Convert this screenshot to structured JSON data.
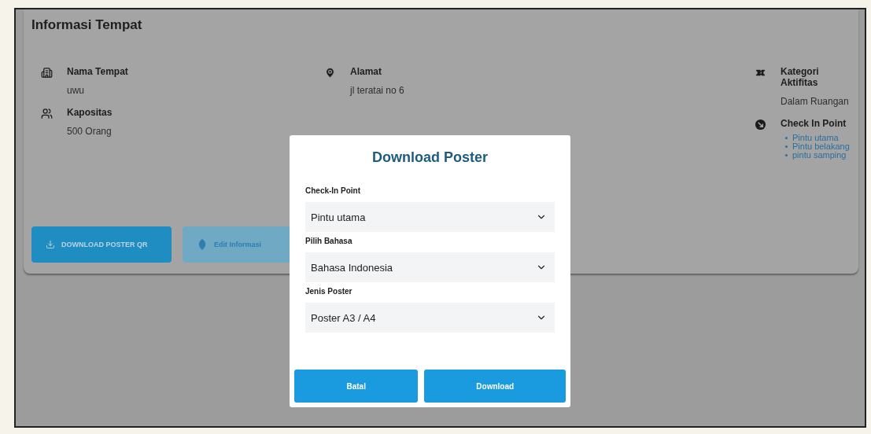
{
  "page": {
    "title": "Informasi Tempat"
  },
  "columns": [
    [
      {
        "kind": "text",
        "label": "Nama Tempat",
        "value": "uwu"
      },
      {
        "kind": "text",
        "label": "Kapositas",
        "value": "500 Orang"
      }
    ],
    [
      {
        "kind": "text",
        "label": "Alamat",
        "value": "jl teratai no 6"
      }
    ],
    [
      {
        "kind": "text",
        "label": "Kategori Aktifitas",
        "value": "Dalam Ruangan"
      },
      {
        "kind": "list",
        "label": "Check In Point",
        "items": [
          "Pintu utama",
          "Pintu belakang",
          "pintu samping"
        ]
      }
    ]
  ],
  "actions": [
    {
      "kind": "primary",
      "label": "DOWNLOAD POSTER QR"
    },
    {
      "kind": "secondary",
      "label": "Edit Informasi"
    }
  ],
  "dialog": {
    "title": "Download Poster",
    "fields": [
      {
        "label": "Check-In Point",
        "value": "Pintu utama"
      },
      {
        "label": "Pilih Bahasa",
        "value": "Bahasa Indonesia"
      },
      {
        "label": "Jenis Poster",
        "value": "Poster A3 / A4"
      }
    ],
    "buttons": [
      "Batal",
      "Download"
    ]
  }
}
